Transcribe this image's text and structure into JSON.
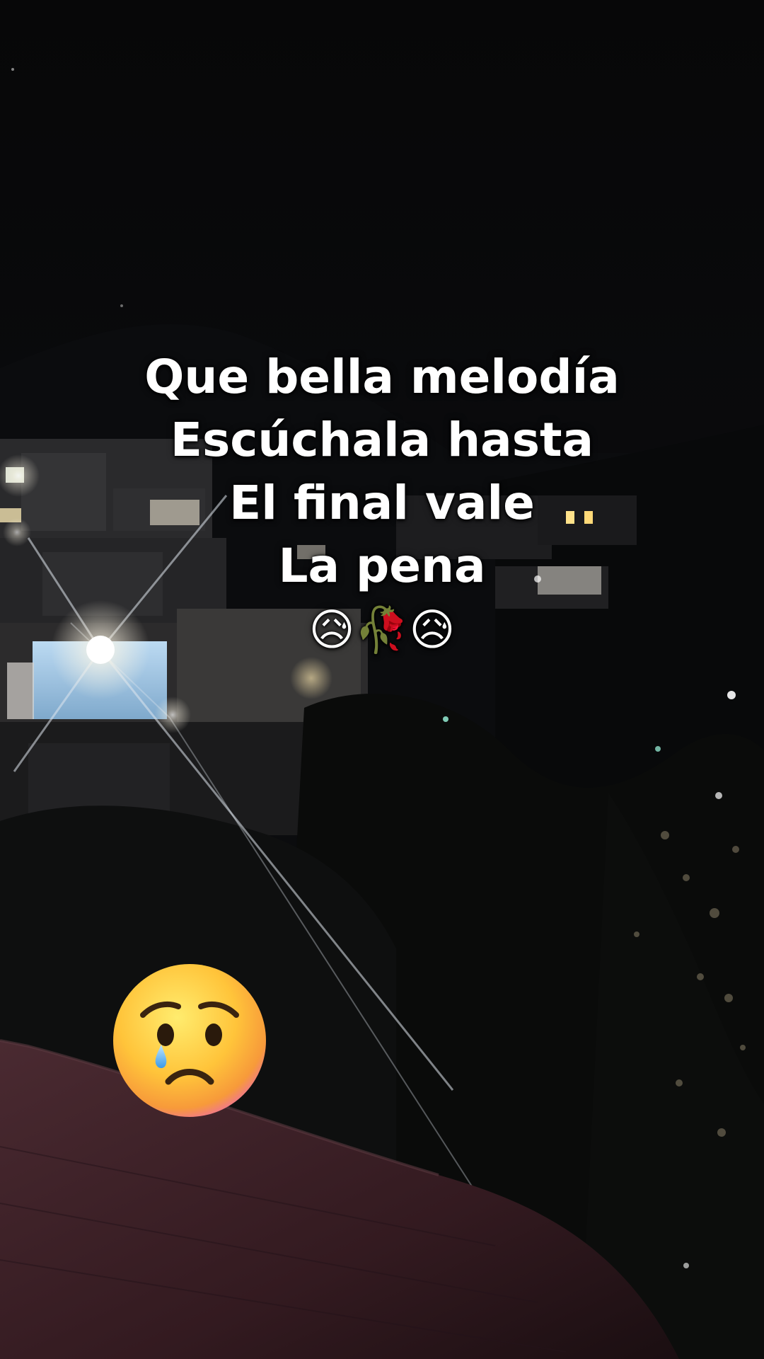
{
  "caption": {
    "line1": "Que bella melodía",
    "line2": "Escúchala hasta",
    "line3": "El final vale",
    "line4": "La pena",
    "emoji_line": "😥🥀😥"
  },
  "sticker": {
    "icon": "crying-face-emoji"
  },
  "colors": {
    "caption_text": "#ffffff",
    "background": "#050506",
    "light_window": "#b9d7f0",
    "roof": "#3a1e25"
  }
}
